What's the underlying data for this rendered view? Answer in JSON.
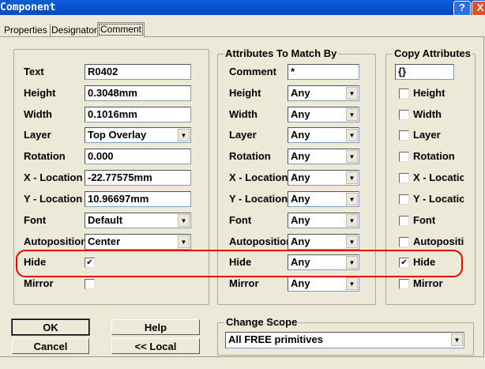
{
  "window": {
    "title": "Component",
    "help_btn": "?",
    "close_btn": "X"
  },
  "tabs": [
    {
      "label": "Properties"
    },
    {
      "label": "Designator"
    },
    {
      "label": "Comment"
    }
  ],
  "properties": [
    {
      "label": "Text",
      "value": "R0402",
      "type": "text"
    },
    {
      "label": "Height",
      "value": "0.3048mm",
      "type": "text"
    },
    {
      "label": "Width",
      "value": "0.1016mm",
      "type": "text"
    },
    {
      "label": "Layer",
      "value": "Top Overlay",
      "type": "select"
    },
    {
      "label": "Rotation",
      "value": " 0.000",
      "type": "text"
    },
    {
      "label": "X - Location",
      "value": "-22.77575mm",
      "type": "text"
    },
    {
      "label": "Y - Location",
      "value": "10.96697mm",
      "type": "text"
    },
    {
      "label": "Font",
      "value": "Default",
      "type": "select"
    },
    {
      "label": "Autoposition",
      "value": "Center",
      "type": "select"
    },
    {
      "label": "Hide",
      "checked": true,
      "type": "check"
    },
    {
      "label": "Mirror",
      "checked": false,
      "type": "check"
    }
  ],
  "match": {
    "title": "Attributes To Match By",
    "rows": [
      {
        "label": "Comment",
        "value": "*"
      },
      {
        "label": "Height",
        "value": "Any"
      },
      {
        "label": "Width",
        "value": "Any"
      },
      {
        "label": "Layer",
        "value": "Any"
      },
      {
        "label": "Rotation",
        "value": "Any"
      },
      {
        "label": "X - Location",
        "value": "Any"
      },
      {
        "label": "Y - Location",
        "value": "Any"
      },
      {
        "label": "Font",
        "value": "Any"
      },
      {
        "label": "Autoposition",
        "value": "Any"
      },
      {
        "label": "Hide",
        "value": "Any"
      },
      {
        "label": "Mirror",
        "value": "Any"
      }
    ]
  },
  "copy": {
    "title": "Copy Attributes",
    "value": "{}",
    "rows": [
      {
        "label": "Height",
        "checked": false
      },
      {
        "label": "Width",
        "checked": false
      },
      {
        "label": "Layer",
        "checked": false
      },
      {
        "label": "Rotation",
        "checked": false
      },
      {
        "label": "X - Location",
        "checked": false
      },
      {
        "label": "Y - Location",
        "checked": false
      },
      {
        "label": "Font",
        "checked": false
      },
      {
        "label": "Autoposition",
        "checked": false
      },
      {
        "label": "Hide",
        "checked": true
      },
      {
        "label": "Mirror",
        "checked": false
      }
    ]
  },
  "buttons": {
    "ok": "OK",
    "cancel": "Cancel",
    "help": "Help",
    "local": "<< Local"
  },
  "scope": {
    "title": "Change Scope",
    "value": "All FREE primitives"
  },
  "highlight_color": "#e00000"
}
